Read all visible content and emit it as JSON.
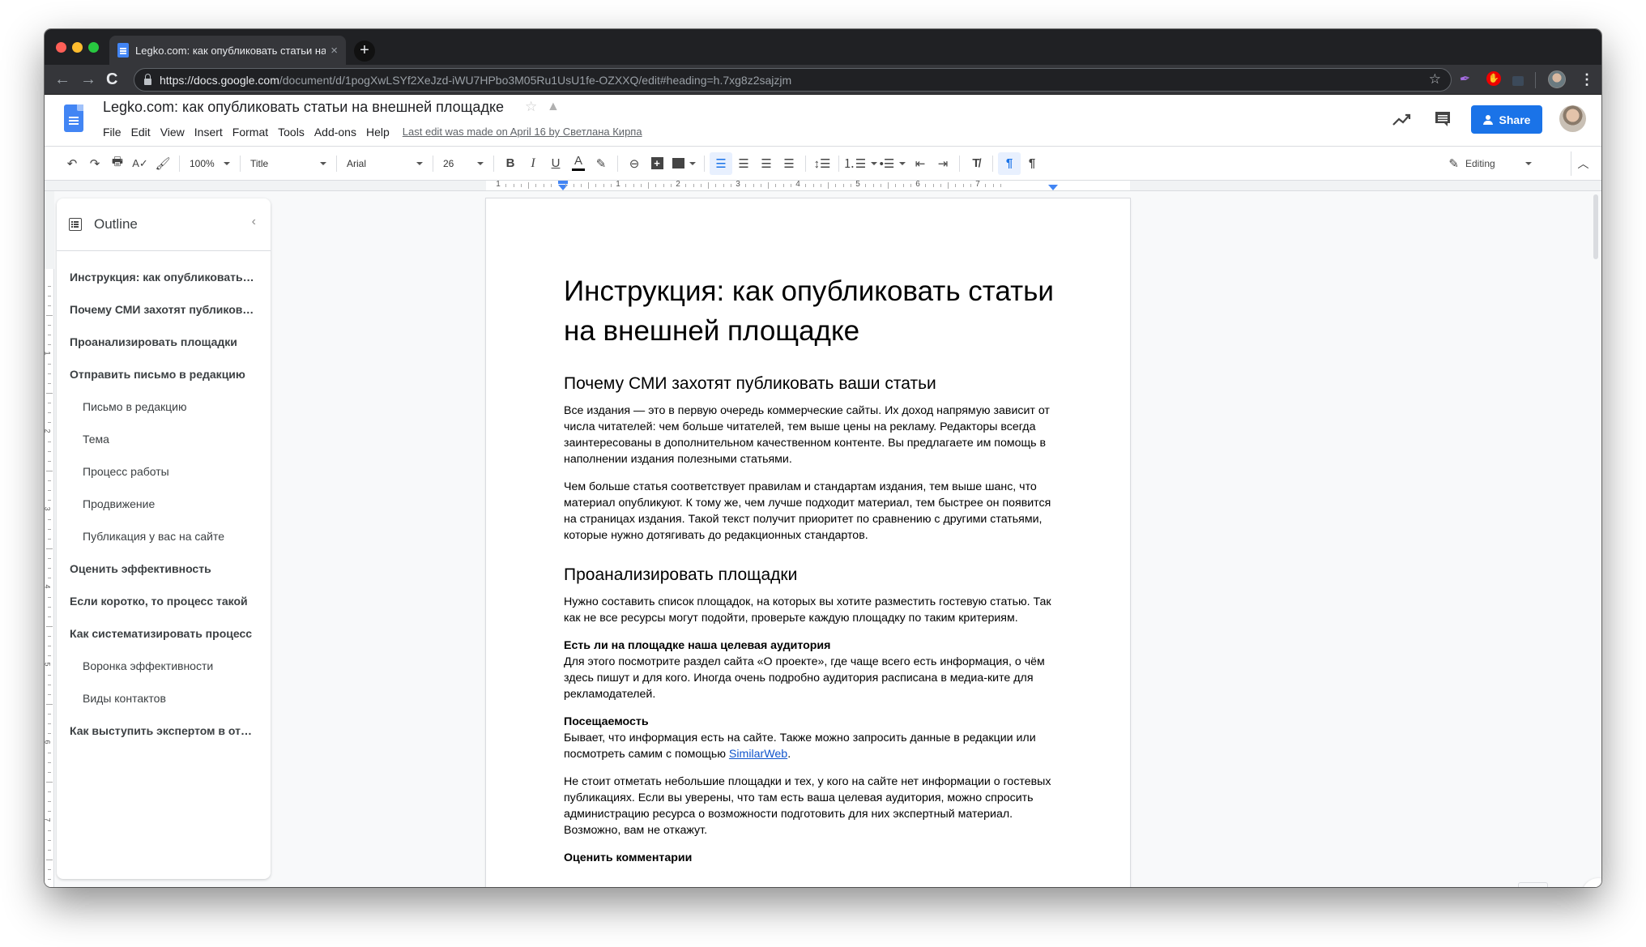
{
  "browser": {
    "tab_title": "Legko.com: как опубликовать статьи на внешней площадке",
    "tab_close": "×",
    "new_tab": "+",
    "url_host": "https://docs.google.com",
    "url_path": "/document/d/1pogXwLSYf2XeJzd-iWU7HPbo3M05Ru1UsU1fe-OZXXQ/edit#heading=h.7xg8z2sajzjm",
    "nav_back": "←",
    "nav_forward": "→",
    "nav_reload": "C",
    "bookmark_star": "☆",
    "menu_kebab": "⋮",
    "extensions": [
      "feather-extension",
      "adblock-extension",
      "lock-extension"
    ]
  },
  "docs_header": {
    "title": "Legko.com: как опубликовать статьи на внешней площадке",
    "star": "☆",
    "drive_icon": "▲",
    "menus": [
      "File",
      "Edit",
      "View",
      "Insert",
      "Format",
      "Tools",
      "Add-ons",
      "Help"
    ],
    "last_edit": "Last edit was made on April 16 by Светлана Кирпа",
    "share_label": "Share",
    "share_color": "#1a73e8"
  },
  "toolbar": {
    "zoom": "100%",
    "style": "Title",
    "font": "Arial",
    "font_size": "26",
    "bold": "B",
    "italic": "I",
    "underline": "U",
    "text_color": "A",
    "mode": "Editing",
    "active_alignment": "left",
    "active_direction": "left-to-right"
  },
  "ruler": {
    "labels": [
      "1",
      "1",
      "2",
      "3",
      "4",
      "5",
      "6",
      "7"
    ]
  },
  "vertical_ruler": {
    "labels": [
      "1",
      "2",
      "3",
      "4",
      "5",
      "6",
      "7"
    ]
  },
  "outline": {
    "title": "Outline",
    "collapse": "‹",
    "items": [
      {
        "label": "Инструкция: как опубликовать статьи на внешней площадке",
        "level": 1
      },
      {
        "label": "Почему СМИ захотят публиковать ваши статьи",
        "level": 1
      },
      {
        "label": "Проанализировать площадки",
        "level": 1
      },
      {
        "label": "Отправить письмо в редакцию",
        "level": 1
      },
      {
        "label": "Письмо в редакцию",
        "level": 2
      },
      {
        "label": "Тема",
        "level": 2
      },
      {
        "label": "Процесс работы",
        "level": 2
      },
      {
        "label": "Продвижение",
        "level": 2
      },
      {
        "label": "Публикация у вас на сайте",
        "level": 2
      },
      {
        "label": "Оценить эффективность",
        "level": 1
      },
      {
        "label": "Если коротко, то процесс такой",
        "level": 1
      },
      {
        "label": "Как систематизировать процесс",
        "level": 1
      },
      {
        "label": "Воронка эффективности",
        "level": 2
      },
      {
        "label": "Виды контактов",
        "level": 2
      },
      {
        "label": "Как выступить экспертом в отраслевом СМИ",
        "level": 1
      }
    ]
  },
  "document": {
    "title": "Инструкция: как опубликовать статьи на внешней площадке",
    "h1_why": "Почему СМИ захотят публиковать ваши статьи",
    "p1": "Все издания — это в первую очередь коммерческие сайты. Их доход напрямую зависит от числа читателей: чем больше читателей, тем выше цены на рекламу. Редакторы всегда заинтересованы в дополнительном качественном контенте. Вы предлагаете им помощь в наполнении издания полезными статьями.",
    "p2": "Чем больше статья соответствует правилам и стандартам издания, тем выше шанс, что материал опубликуют. К тому же, чем лучше подходит материал, тем быстрее он появится на страницах издания. Такой текст получит приоритет по сравнению с другими статьями, которые нужно дотягивать до редакционных стандартов.",
    "h1_analyze": "Проанализировать площадки",
    "p3": "Нужно составить список площадок, на которых вы хотите разместить гостевую статью. Так как не все ресурсы могут подойти, проверьте каждую площадку по таким критериям.",
    "crit1_title": "Есть ли на площадке наша целевая аудитория",
    "crit1_text": "Для этого посмотрите раздел сайта «О проекте», где чаще всего есть информация, о чём здесь пишут и для кого. Иногда очень подробно аудитория расписана в медиа-ките для рекламодателей.",
    "crit2_title": "Посещаемость",
    "crit2_text": "Бывает, что информация есть на сайте. Также можно запросить данные в редакции или посмотреть самим с помощью ",
    "crit2_link": "SimilarWeb",
    "crit2_end": ".",
    "p4": "Не стоит отметать небольшие площадки и тех, у кого на сайте нет информации о гостевых публикациях. Если вы уверены, что там есть ваша целевая аудитория, можно спросить администрацию ресурса о возможности подготовить для них экспертный материал. Возможно, вам не откажут.",
    "crit3_title": "Оценить комментарии"
  },
  "side": {
    "explore": "✦",
    "toggle": "‹"
  }
}
